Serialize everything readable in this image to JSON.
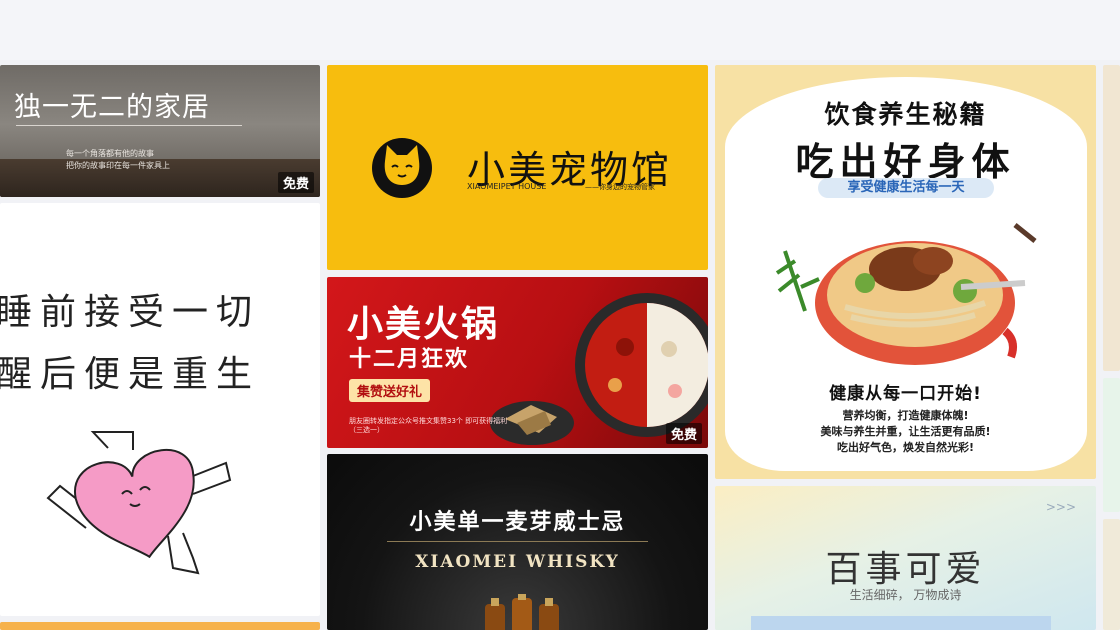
{
  "free_label": "免费",
  "cards": {
    "home": {
      "title": "独一无二的家居",
      "sub_line1": "每一个角落都有他的故事",
      "sub_line2": "把你的故事印在每一件家具上"
    },
    "sleep": {
      "line1": "睡前接受一切",
      "line2": "醒后便是重生"
    },
    "pet": {
      "name": "小美宠物馆",
      "english": "XIAOMEIPET HOUSE",
      "tag": "——你身边的宠物管家"
    },
    "hotpot": {
      "title": "小美火锅",
      "subtitle": "十二月狂欢",
      "badge": "集赞送好礼",
      "note": "朋友圈转发指定公众号推文集赞33个 即可获得福利（三选一）"
    },
    "whisky": {
      "title": "小美单一麦芽威士忌",
      "english": "XIAOMEI WHISKY"
    },
    "food": {
      "title1": "饮食养生秘籍",
      "title2": "吃出好身体",
      "pill": "享受健康生活每一天",
      "heading": "健康从每一口开始!",
      "body1": "营养均衡，打造健康体魄!",
      "body2": "美味与养生并重，让生活更有品质!",
      "body3": "吃出好气色，焕发自然光彩!"
    },
    "cute": {
      "title": "百事可爱",
      "subtitle": "生活细碎，  万物成诗",
      "arrows": ">>>"
    }
  },
  "colors": {
    "pet_bg": "#f7bd0e",
    "hotpot_bg": "#d3171a",
    "food_bg": "#f7e1a4",
    "pill_text": "#2a66b8"
  }
}
